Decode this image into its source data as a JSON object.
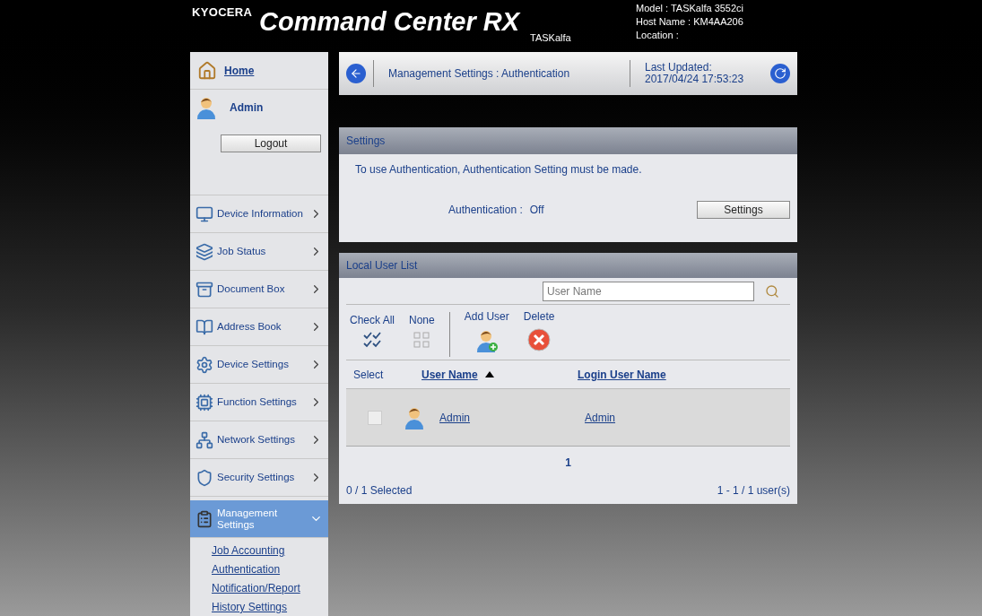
{
  "header": {
    "brand": "KYOCERA",
    "title": "Command Center RX",
    "product": "TASKalfa",
    "info": [
      "Model : TASKalfa 3552ci",
      "Host Name : KM4AA206",
      "Location :"
    ]
  },
  "sidebar": {
    "home": "Home",
    "user": "Admin",
    "logout": "Logout",
    "items": [
      {
        "label": "Device Information",
        "selected": false,
        "expanded": false
      },
      {
        "label": "Job Status",
        "selected": false,
        "expanded": false
      },
      {
        "label": "Document Box",
        "selected": false,
        "expanded": false
      },
      {
        "label": "Address Book",
        "selected": false,
        "expanded": false
      },
      {
        "label": "Device Settings",
        "selected": false,
        "expanded": false
      },
      {
        "label": "Function Settings",
        "selected": false,
        "expanded": false
      },
      {
        "label": "Network Settings",
        "selected": false,
        "expanded": false
      },
      {
        "label": "Security Settings",
        "selected": false,
        "expanded": false
      },
      {
        "label": "Management Settings",
        "selected": true,
        "expanded": true,
        "children": [
          {
            "label": "Job Accounting"
          },
          {
            "label": "Authentication"
          },
          {
            "label": "Notification/Report"
          },
          {
            "label": "History Settings"
          }
        ]
      }
    ]
  },
  "breadcrumb": {
    "path": "Management Settings : Authentication",
    "updated_label": "Last Updated:",
    "updated": "2017/04/24 17:53:23"
  },
  "settings_panel": {
    "title": "Settings",
    "message": "To use Authentication, Authentication Setting must be made.",
    "status_label": "Authentication :",
    "status_value": "Off",
    "button": "Settings"
  },
  "user_list": {
    "title": "Local User List",
    "search": {
      "placeholder": "User Name"
    },
    "actions": [
      {
        "label": "Check All",
        "kind": "checkall"
      },
      {
        "label": "None",
        "kind": "none"
      },
      {
        "label": "Add User",
        "kind": "add"
      },
      {
        "label": "Delete",
        "kind": "delete"
      }
    ],
    "columns": [
      "Select",
      "User Name",
      "Login User Name"
    ],
    "rows": [
      {
        "user_name": "Admin",
        "login": "Admin",
        "checked": false
      }
    ],
    "page": "1",
    "selected_count": "0 / 1 Selected",
    "range": "1 - 1 / 1 user(s)"
  }
}
